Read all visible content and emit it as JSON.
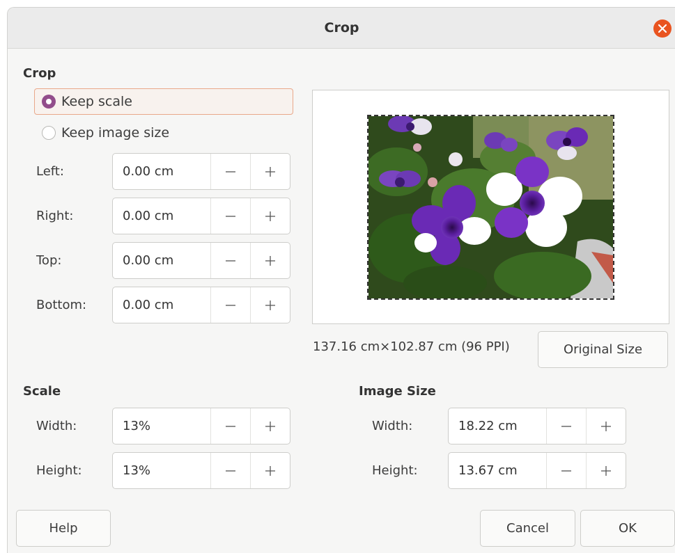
{
  "window": {
    "title": "Crop"
  },
  "crop": {
    "section_title": "Crop",
    "keep_scale_label": "Keep scale",
    "keep_image_size_label": "Keep image size",
    "selected": "keep_scale",
    "fields": [
      {
        "label": "Left:",
        "value": "0.00 cm"
      },
      {
        "label": "Right:",
        "value": "0.00 cm"
      },
      {
        "label": "Top:",
        "value": "0.00 cm"
      },
      {
        "label": "Bottom:",
        "value": "0.00 cm"
      }
    ]
  },
  "preview": {
    "size_text": "137.16 cm×102.87 cm (96 PPI)",
    "original_size_label": "Original Size"
  },
  "scale": {
    "section_title": "Scale",
    "width_label": "Width:",
    "width_value": "13%",
    "height_label": "Height:",
    "height_value": "13%"
  },
  "image_size": {
    "section_title": "Image Size",
    "width_label": "Width:",
    "width_value": "18.22 cm",
    "height_label": "Height:",
    "height_value": "13.67 cm"
  },
  "buttons": {
    "help": "Help",
    "cancel": "Cancel",
    "ok": "OK"
  },
  "colors": {
    "accent": "#924d8b",
    "close": "#e95420",
    "focus_border": "#e9a88a"
  },
  "icons": {
    "close": "close-icon",
    "minus": "minus-icon",
    "plus": "plus-icon"
  }
}
